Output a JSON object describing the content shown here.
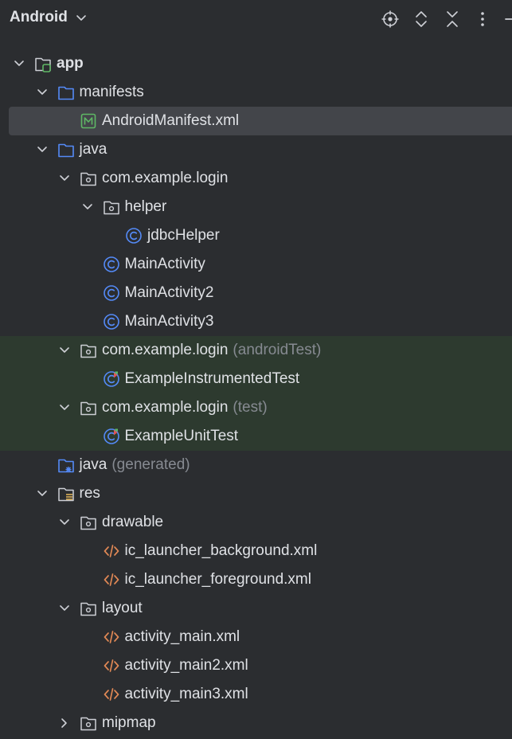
{
  "header": {
    "view_name": "Android",
    "toolbar_icons": [
      "locate-icon",
      "expand-all-icon",
      "collapse-all-icon",
      "more-icon",
      "hide-icon"
    ]
  },
  "colors": {
    "background": "#2b2d30",
    "selected_row": "#43454a",
    "test_row": "#2d3a2f",
    "folder_blue": "#548af7",
    "class_blue": "#548af7",
    "xml_orange": "#e08855",
    "manifest_green": "#5fb865",
    "suffix_grey": "#868a91"
  },
  "tree": [
    {
      "label": "app",
      "bold": true,
      "icon": "module-icon",
      "level": 0,
      "chevron": "down"
    },
    {
      "label": "manifests",
      "icon": "folder-icon",
      "level": 1,
      "chevron": "down"
    },
    {
      "label": "AndroidManifest.xml",
      "icon": "manifest-file-icon",
      "level": 2,
      "selected": true
    },
    {
      "label": "java",
      "icon": "folder-icon",
      "level": 1,
      "chevron": "down"
    },
    {
      "label": "com.example.login",
      "icon": "package-icon",
      "level": 2,
      "chevron": "down"
    },
    {
      "label": "helper",
      "icon": "package-icon",
      "level": 3,
      "chevron": "down"
    },
    {
      "label": "jdbcHelper",
      "icon": "class-icon",
      "level": 4
    },
    {
      "label": "MainActivity",
      "icon": "class-icon",
      "level": 3
    },
    {
      "label": "MainActivity2",
      "icon": "class-icon",
      "level": 3
    },
    {
      "label": "MainActivity3",
      "icon": "class-icon",
      "level": 3
    },
    {
      "label": "com.example.login",
      "suffix": "(androidTest)",
      "icon": "package-icon",
      "level": 2,
      "chevron": "down",
      "test": true
    },
    {
      "label": "ExampleInstrumentedTest",
      "icon": "test-class-icon",
      "level": 3,
      "test": true
    },
    {
      "label": "com.example.login",
      "suffix": "(test)",
      "icon": "package-icon",
      "level": 2,
      "chevron": "down",
      "test": true
    },
    {
      "label": "ExampleUnitTest",
      "icon": "test-class-icon",
      "level": 3,
      "test": true
    },
    {
      "label": "java",
      "suffix": "(generated)",
      "icon": "generated-folder-icon",
      "level": 1
    },
    {
      "label": "res",
      "icon": "resource-folder-icon",
      "level": 1,
      "chevron": "down"
    },
    {
      "label": "drawable",
      "icon": "package-icon",
      "level": 2,
      "chevron": "down"
    },
    {
      "label": "ic_launcher_background.xml",
      "icon": "xml-file-icon",
      "level": 3
    },
    {
      "label": "ic_launcher_foreground.xml",
      "icon": "xml-file-icon",
      "level": 3
    },
    {
      "label": "layout",
      "icon": "package-icon",
      "level": 2,
      "chevron": "down"
    },
    {
      "label": "activity_main.xml",
      "icon": "xml-file-icon",
      "level": 3
    },
    {
      "label": "activity_main2.xml",
      "icon": "xml-file-icon",
      "level": 3
    },
    {
      "label": "activity_main3.xml",
      "icon": "xml-file-icon",
      "level": 3
    },
    {
      "label": "mipmap",
      "icon": "package-icon",
      "level": 2,
      "chevron": "right"
    }
  ]
}
